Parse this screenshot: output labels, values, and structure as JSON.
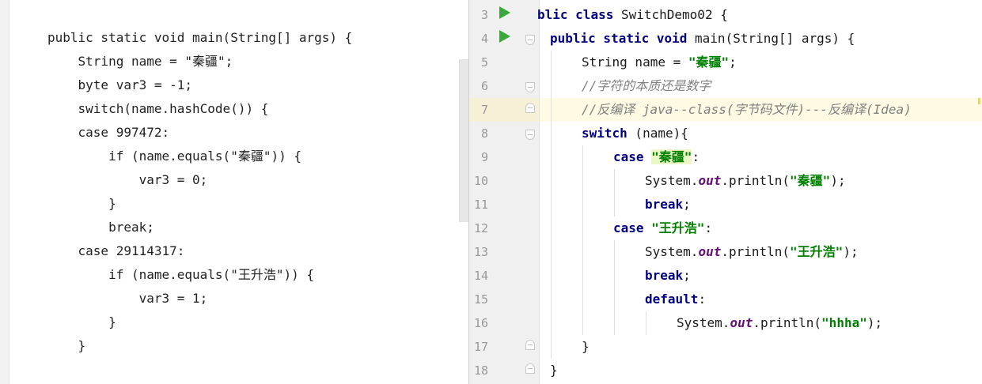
{
  "left_pane": {
    "lines": [
      "public static void main(String[] args) {",
      "    String name = \"秦疆\";",
      "    byte var3 = -1;",
      "    switch(name.hashCode()) {",
      "    case 997472:",
      "        if (name.equals(\"秦疆\")) {",
      "            var3 = 0;",
      "        }",
      "        break;",
      "    case 29114317:",
      "        if (name.equals(\"王升浩\")) {",
      "            var3 = 1;",
      "        }",
      "    }"
    ]
  },
  "editor": {
    "line_numbers": [
      "3",
      "4",
      "5",
      "6",
      "7",
      "8",
      "9",
      "10",
      "11",
      "12",
      "13",
      "14",
      "15",
      "16",
      "17",
      "18"
    ],
    "current_line": "7",
    "code": {
      "l3_kw_public_partial": "blic",
      "l3_kw_class": "class",
      "l3_rest": " SwitchDemo02 {",
      "l4_kw": "public static void",
      "l4_rest": " main(String[] args) {",
      "l5_pre": "String name = ",
      "l5_str": "\"秦疆\"",
      "l5_end": ";",
      "l6_comment": "//字符的本质还是数字",
      "l7_comment": "//反编译 java--class(字节码文件)---反编译(Idea)",
      "l8_kw": "switch",
      "l8_rest": " (name){",
      "l9_kw": "case",
      "l9_str": "\"秦疆\"",
      "l9_end": ":",
      "l10_pre": "System.",
      "l10_out": "out",
      "l10_mid": ".println(",
      "l10_str": "\"秦疆\"",
      "l10_end": ");",
      "l11_kw": "break",
      "l11_end": ";",
      "l12_kw": "case",
      "l12_str": "\"王升浩\"",
      "l12_end": ":",
      "l13_pre": "System.",
      "l13_out": "out",
      "l13_mid": ".println(",
      "l13_str": "\"王升浩\"",
      "l13_end": ");",
      "l14_kw": "break",
      "l14_end": ";",
      "l15_kw": "default",
      "l15_end": ":",
      "l16_pre": "System.",
      "l16_out": "out",
      "l16_mid": ".println(",
      "l16_str": "\"hhha\"",
      "l16_end": ");",
      "l17": "}",
      "l18": "}"
    }
  },
  "colors": {
    "keyword": "#000080",
    "string": "#008000",
    "comment": "#808080",
    "static_field": "#660e7a",
    "run_icon": "#3aa83a",
    "current_line": "#fffae3"
  },
  "icons": [
    "run-icon",
    "fold-icon"
  ]
}
